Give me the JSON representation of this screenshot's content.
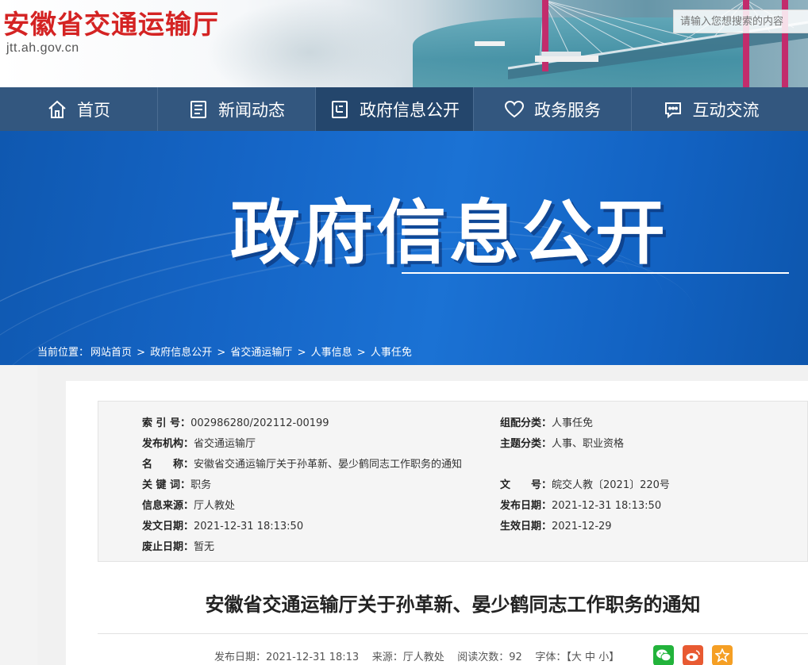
{
  "header": {
    "site_title": "安徽省交通运输厅",
    "domain": "jtt.ah.gov.cn",
    "search_placeholder": "请输入您想搜索的内容"
  },
  "nav": [
    {
      "label": "首页",
      "icon": "home-icon"
    },
    {
      "label": "新闻动态",
      "icon": "news-icon"
    },
    {
      "label": "政府信息公开",
      "icon": "document-icon"
    },
    {
      "label": "政务服务",
      "icon": "heart-icon"
    },
    {
      "label": "互动交流",
      "icon": "chat-icon"
    }
  ],
  "banner": {
    "title": "政府信息公开"
  },
  "breadcrumb": {
    "prefix": "当前位置：",
    "items": [
      "网站首页",
      "政府信息公开",
      "省交通运输厅",
      "人事信息",
      "人事任免"
    ],
    "separator": ">"
  },
  "meta": {
    "index_no_label": "索 引 号：",
    "index_no": "002986280/202112-00199",
    "category_label": "组配分类：",
    "category": "人事任免",
    "publisher_label": "发布机构：",
    "publisher": "省交通运输厅",
    "topic_label": "主题分类：",
    "topic": "人事、职业资格",
    "name_label": "名　　称：",
    "name": "安徽省交通运输厅关于孙革新、晏少鹤同志工作职务的通知",
    "keywords_label": "关 键 词：",
    "keywords": "职务",
    "doc_no_label": "文　　号：",
    "doc_no": "皖交人教〔2021〕220号",
    "source_label": "信息来源：",
    "source": "厅人教处",
    "publish_date_label": "发布日期：",
    "publish_date": "2021-12-31 18:13:50",
    "issue_date_label": "发文日期：",
    "issue_date": "2021-12-31 18:13:50",
    "effective_date_label": "生效日期：",
    "effective_date": "2021-12-29",
    "expiry_date_label": "废止日期：",
    "expiry_date": "暂无"
  },
  "article": {
    "title": "安徽省交通运输厅关于孙革新、晏少鹤同志工作职务的通知",
    "publish_label": "发布日期：",
    "publish": "2021-12-31 18:13",
    "source_label": "来源：",
    "source": "厅人教处",
    "views_label": "阅读次数：",
    "views": "92",
    "font_label": "字体：【",
    "font_large": "大",
    "font_medium": "中",
    "font_small": "小",
    "font_close": "】"
  },
  "share": [
    {
      "name": "wechat-icon",
      "color": "#22b33b"
    },
    {
      "name": "weibo-icon",
      "color": "#e85a32"
    },
    {
      "name": "star-icon",
      "color": "#f59f24"
    }
  ],
  "colors": {
    "brand_red": "#d42323",
    "nav_bg": "#33577f",
    "nav_active": "#24466c",
    "banner_blue": "#1565c6"
  }
}
